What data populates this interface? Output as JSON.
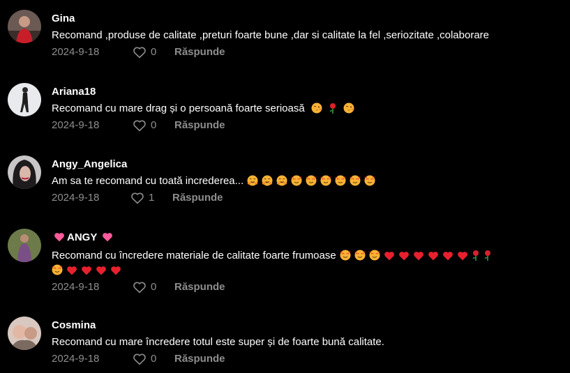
{
  "comments": [
    {
      "username": "Gina",
      "text": "Recomand ,produse de calitate ,preturi foarte bune ,dar si calitate la fel ,seriozitate ,colaborare",
      "emojis": [],
      "date": "2024-9-18",
      "likes": "0",
      "reply_label": "Răspunde"
    },
    {
      "username": "Ariana18",
      "text": "Recomand cu mare drag și o persoană foarte serioasă",
      "emojis": [
        "kiss-face-icon",
        "rose-icon",
        "kiss-face-icon"
      ],
      "date": "2024-9-18",
      "likes": "0",
      "reply_label": "Răspunde"
    },
    {
      "username": "Angy_Angelica",
      "text": "Am sa te recomand cu toată increderea...",
      "emojis": [
        "hug-face-icon",
        "hug-face-icon",
        "hug-face-icon",
        "hearts-face-icon",
        "hearts-face-icon",
        "hearts-face-icon",
        "hearts-face-icon",
        "hearts-face-icon",
        "hearts-face-icon"
      ],
      "date": "2024-9-18",
      "likes": "1",
      "reply_label": "Răspunde"
    },
    {
      "username": "ANGY",
      "username_decor": "pink-heart-icon",
      "text": "Recomand cu încredere materiale de calitate foarte frumoase",
      "emojis": [
        "hearts-face-icon",
        "hearts-face-icon",
        "hearts-face-icon",
        "red-heart-icon",
        "red-heart-icon",
        "red-heart-icon",
        "red-heart-icon",
        "red-heart-icon",
        "red-heart-icon",
        "rose-icon",
        "rose-icon"
      ],
      "emojis_line2": [
        "hearts-face-icon",
        "red-heart-icon",
        "red-heart-icon",
        "red-heart-icon",
        "red-heart-icon"
      ],
      "date": "2024-9-18",
      "likes": "0",
      "reply_label": "Răspunde"
    },
    {
      "username": "Cosmina",
      "text": "Recomand cu mare încredere totul este super și de foarte bună calitate.",
      "emojis": [],
      "date": "2024-9-18",
      "likes": "0",
      "reply_label": "Răspunde"
    }
  ],
  "colors": {
    "background": "#000000",
    "text": "#ffffff",
    "meta": "#8c8c8c",
    "pink_heart": "#ff5a9a",
    "red_heart": "#e8202e"
  }
}
